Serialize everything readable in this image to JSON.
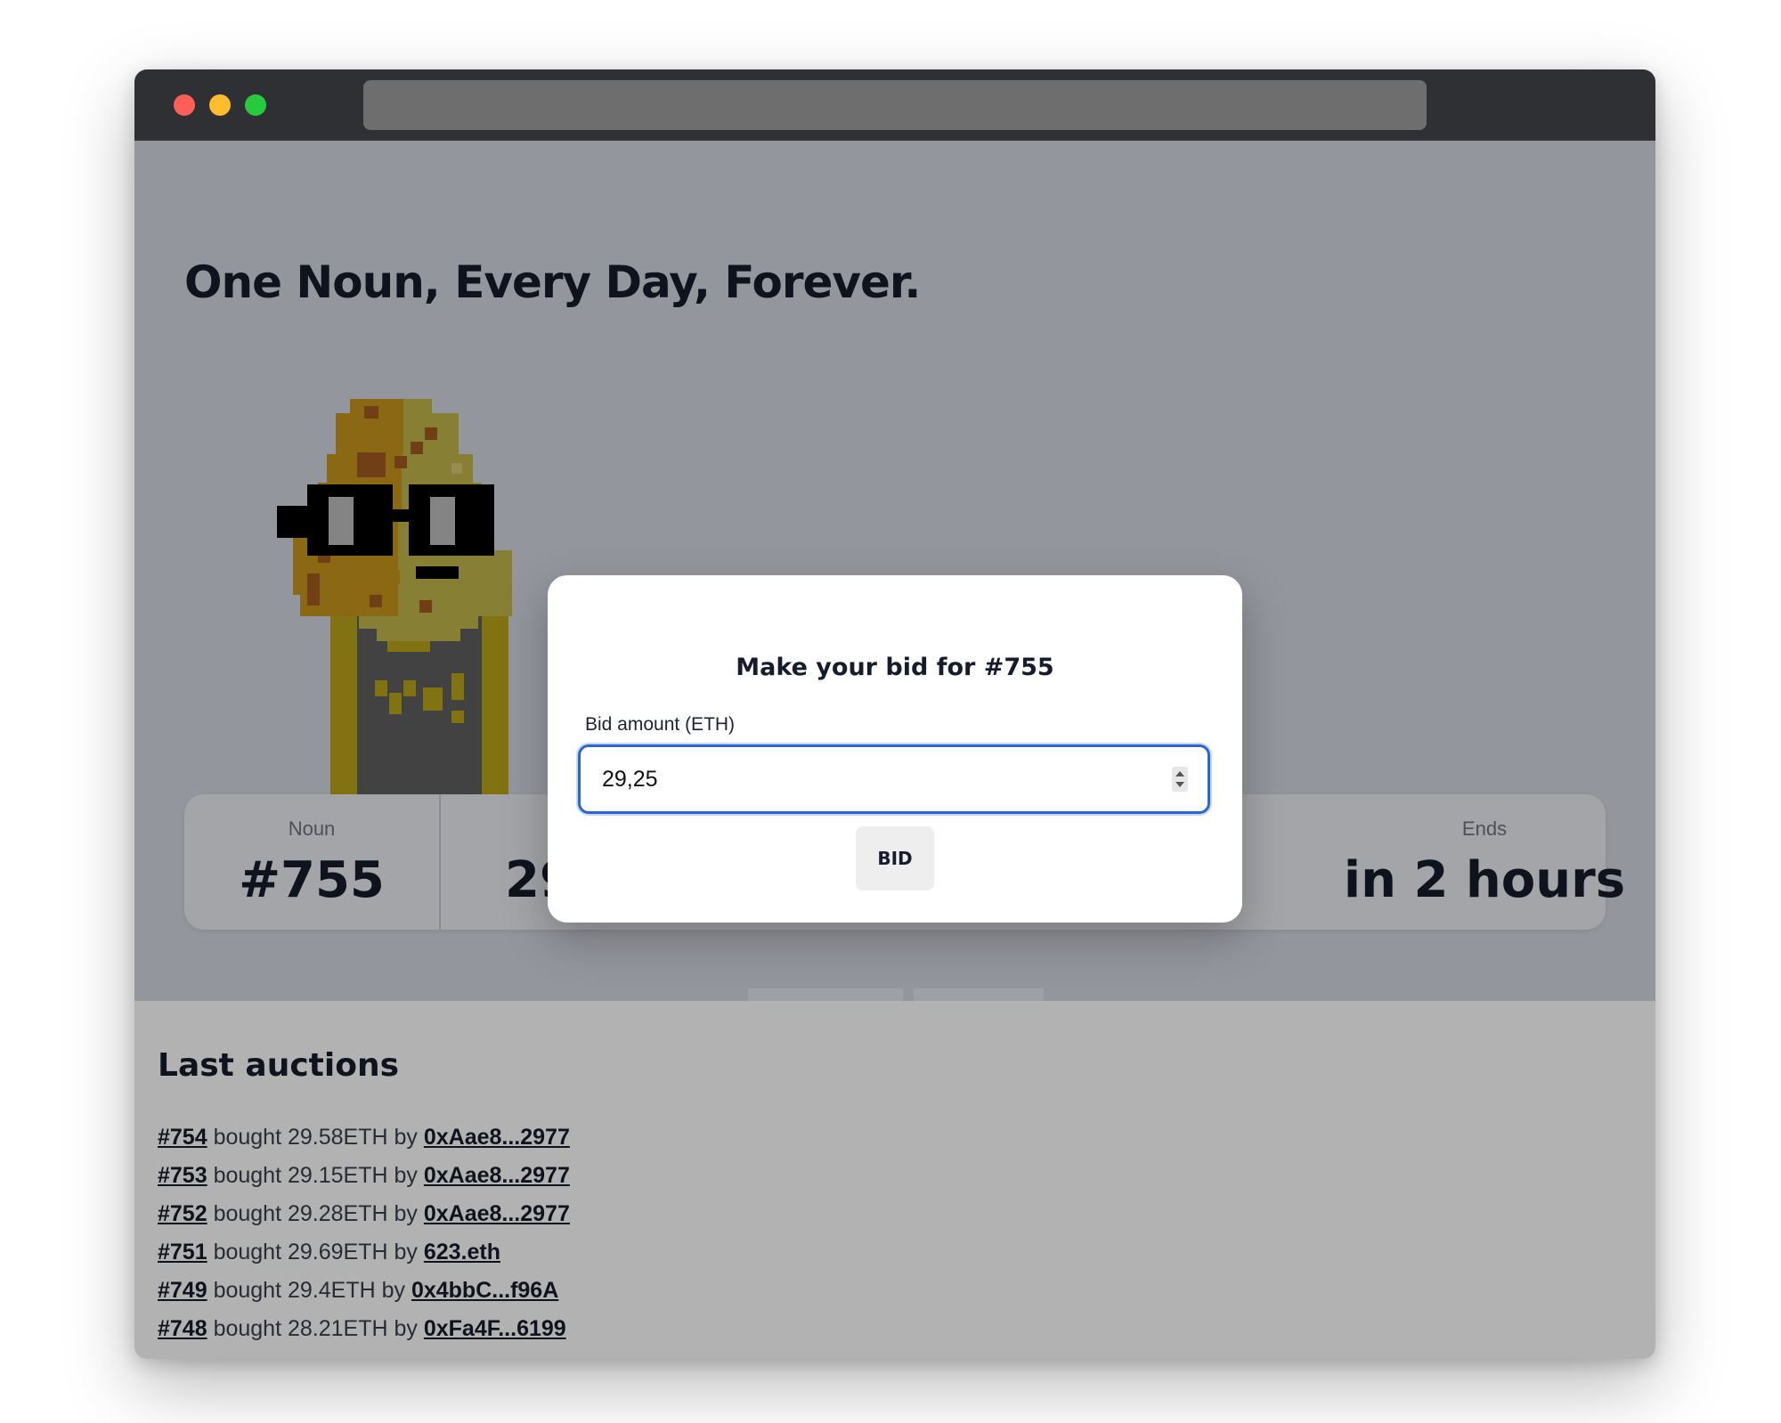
{
  "colors": {
    "hero_background": "#d5d7e1",
    "headline": "#151c2b",
    "focus_ring": "#2a64d6",
    "titlebar": "#2f3033"
  },
  "hero": {
    "headline": "One Noun, Every Day, Forever.",
    "noun_image": "pixel-art-noun-gold-head-black-glasses"
  },
  "stats": {
    "noun_label": "Noun",
    "noun_value": "#755",
    "current_bid_partial": "29",
    "ends_label": "Ends",
    "ends_value": "in 2 hours"
  },
  "modal": {
    "title": "Make your bid for #755",
    "bid_label": "Bid amount (ETH)",
    "bid_value": "29,25",
    "bid_button": "BID"
  },
  "auctions": {
    "title": "Last auctions",
    "items": [
      {
        "noun": "#754",
        "text": " bought 29.58ETH by ",
        "buyer": "0xAae8...2977"
      },
      {
        "noun": "#753",
        "text": " bought 29.15ETH by ",
        "buyer": "0xAae8...2977"
      },
      {
        "noun": "#752",
        "text": " bought 29.28ETH by ",
        "buyer": "0xAae8...2977"
      },
      {
        "noun": "#751",
        "text": " bought 29.69ETH by ",
        "buyer": "623.eth"
      },
      {
        "noun": "#749",
        "text": " bought 29.4ETH by ",
        "buyer": "0x4bbC...f96A"
      },
      {
        "noun": "#748",
        "text": " bought 28.21ETH by ",
        "buyer": "0xFa4F...6199"
      }
    ]
  }
}
